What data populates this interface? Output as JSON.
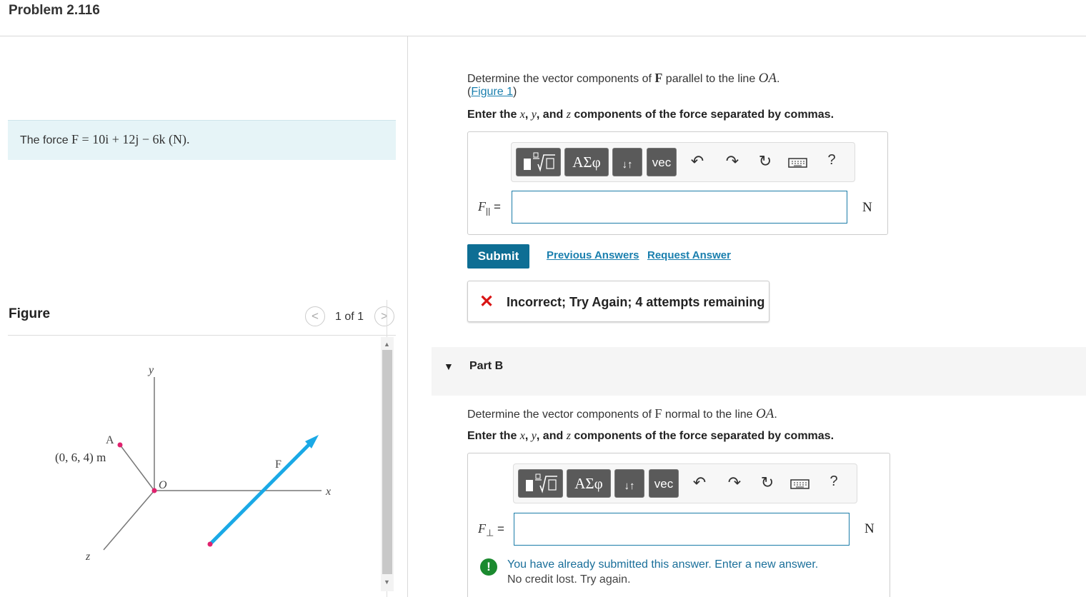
{
  "header": {
    "title": "Problem 2.116"
  },
  "problem": {
    "prefix": "The force ",
    "math": "F = 10i + 12j − 6k (N)."
  },
  "figure": {
    "label": "Figure",
    "pager": "1 of 1",
    "prev_icon": "chevron-left-icon",
    "next_icon": "chevron-right-icon",
    "labels": {
      "y": "y",
      "x": "x",
      "z": "z",
      "A": "A",
      "O": "O",
      "F": "F",
      "coord": "(0, 6, 4) m"
    },
    "colors": {
      "force_arrow": "#1aa9e6",
      "point": "#e0226e",
      "axis": "#777777"
    }
  },
  "partA": {
    "q_prefix": "Determine the vector components of ",
    "q_F": "F",
    "q_mid": " parallel to the line ",
    "q_OA": "OA",
    "q_end": ".",
    "fig_link_open": "(",
    "fig_link": "Figure 1",
    "fig_link_close": ")",
    "instr_prefix": "Enter the ",
    "instr_x": "x",
    "instr_sep1": ", ",
    "instr_y": "y",
    "instr_and": ", and ",
    "instr_z": "z",
    "instr_suffix": " components of the force separated by commas.",
    "eq_label": "F",
    "eq_sub": "||",
    "eq_sign": " =",
    "input_value": "",
    "unit": "N",
    "submit": "Submit",
    "prev_answers": "Previous Answers",
    "request_answer": "Request Answer",
    "feedback_icon": "✕",
    "feedback": "Incorrect; Try Again; 4 attempts remaining"
  },
  "toolbar": {
    "template_icon": "fraction-sqrt-icon",
    "greek": "ΑΣφ",
    "arrows": "↓↑",
    "vec": "vec",
    "undo_icon": "undo-icon",
    "redo_icon": "redo-icon",
    "reset_icon": "reset-icon",
    "keyboard_icon": "keyboard-icon",
    "help": "?"
  },
  "partB": {
    "header_icon": "▼",
    "header": "Part B",
    "q_prefix": "Determine the vector components of ",
    "q_F": "F",
    "q_mid": " normal to the line ",
    "q_OA": "OA",
    "q_end": ".",
    "instr_prefix": "Enter the ",
    "instr_x": "x",
    "instr_sep1": ", ",
    "instr_y": "y",
    "instr_and": ", and ",
    "instr_z": "z",
    "instr_suffix": " components of the force separated by commas.",
    "eq_label": "F",
    "eq_sub": "⊥",
    "eq_sign": " =",
    "input_value": "",
    "unit": "N",
    "warn_icon": "!",
    "warn_line1": "You have already submitted this answer. Enter a new answer.",
    "warn_line2": "No credit lost. Try again."
  }
}
